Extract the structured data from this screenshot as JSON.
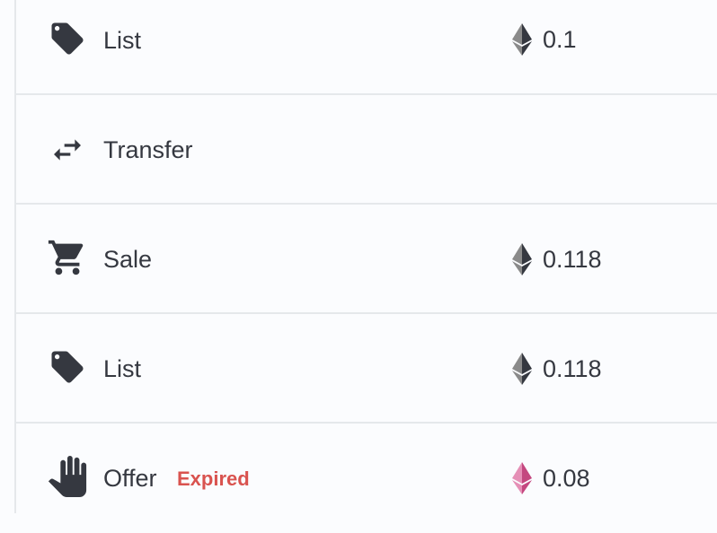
{
  "colors": {
    "text": "#353840",
    "expired": "#d9534f",
    "eth_gray": "#353840",
    "eth_pink": "#c4477f",
    "divider": "#e5e8eb",
    "background": "#fbfcfe"
  },
  "rows": [
    {
      "event": "List",
      "icon": "tag-icon",
      "price": "0.1",
      "currency_icon": "eth-icon"
    },
    {
      "event": "Transfer",
      "icon": "transfer-arrows-icon",
      "price": "",
      "currency_icon": ""
    },
    {
      "event": "Sale",
      "icon": "shopping-cart-icon",
      "price": "0.118",
      "currency_icon": "eth-icon"
    },
    {
      "event": "List",
      "icon": "tag-icon",
      "price": "0.118",
      "currency_icon": "eth-icon"
    },
    {
      "event": "Offer",
      "icon": "hand-icon",
      "badge": "Expired",
      "price": "0.08",
      "currency_icon": "weth-icon"
    }
  ]
}
